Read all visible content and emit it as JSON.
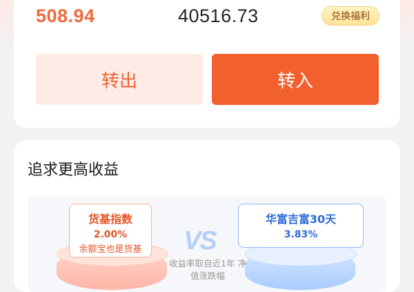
{
  "summary": {
    "left_value": "508.94",
    "mid_value": "40516.73",
    "exchange_label": "兑换福利"
  },
  "actions": {
    "transfer_out": "转出",
    "transfer_in": "转入"
  },
  "higher_yield": {
    "title": "追求更高收益",
    "left_product": {
      "name": "货基指数",
      "rate": "2.00%",
      "subtitle": "余额宝也是货基"
    },
    "vs_label": "VS",
    "right_product": {
      "name": "华富吉富30天",
      "rate": "3.83%"
    },
    "note": "收益率取自近1年 净值涨跌幅"
  },
  "colors": {
    "accent": "#f2602e",
    "accent_light": "#fdece6",
    "blue": "#2d6bd6"
  }
}
